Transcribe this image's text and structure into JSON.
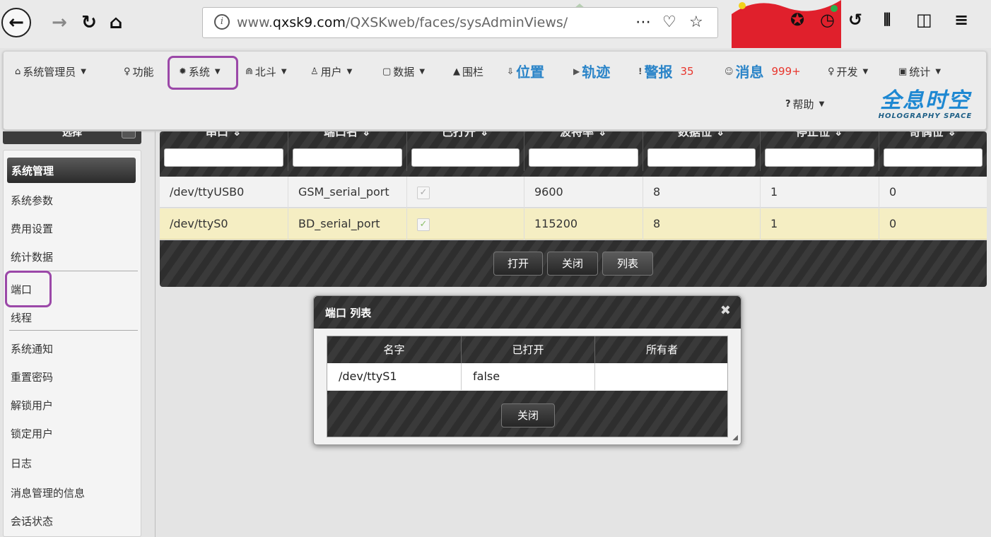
{
  "browser": {
    "url_prefix": "www.",
    "url_host": "qxsk9.com",
    "url_path": "/QXSKweb/faces/sysAdminViews/",
    "icons": [
      "back-icon",
      "forward-icon",
      "reload-icon",
      "home-icon",
      "info-icon",
      "more-icon",
      "pocket-icon",
      "bookmark-star-icon",
      "extension-icon",
      "clock-icon",
      "history-icon",
      "library-icon",
      "sidebar-icon",
      "hamburger-menu-icon"
    ]
  },
  "navbar": {
    "items": [
      {
        "icon": "⌂",
        "label": "系统管理员",
        "caret": true
      },
      {
        "icon": "♀",
        "label": "功能",
        "caret": false
      },
      {
        "icon": "✹",
        "label": "系统",
        "caret": true
      },
      {
        "icon": "⋒",
        "label": "北斗",
        "caret": true
      },
      {
        "icon": "♙",
        "label": "用户",
        "caret": true
      },
      {
        "icon": "▢",
        "label": "数据",
        "caret": true
      },
      {
        "icon": "▲",
        "label": "围栏",
        "caret": false
      }
    ],
    "big_items": [
      {
        "icon": "⇩",
        "label": "位置"
      },
      {
        "icon": "▶",
        "label": "轨迹"
      },
      {
        "icon": "!",
        "label": "警报",
        "badge": "35"
      },
      {
        "icon": "☺",
        "label": "消息",
        "badge": "999+"
      }
    ],
    "right_items": [
      {
        "icon": "♀",
        "label": "开发",
        "caret": true
      },
      {
        "icon": "▣",
        "label": "统计",
        "caret": true
      }
    ],
    "help": {
      "icon": "?",
      "label": "帮助"
    },
    "logo": {
      "zh": "全息时空",
      "en": "HOLOGRAPHY SPACE"
    }
  },
  "sidebar": {
    "header": "选择",
    "items": [
      "系统管理",
      "系统参数",
      "费用设置",
      "统计数据",
      "端口",
      "线程",
      "系统通知",
      "重置密码",
      "解锁用户",
      "锁定用户",
      "日志",
      "消息管理的信息",
      "会话状态"
    ],
    "active": "系统管理"
  },
  "table": {
    "columns": [
      "串口",
      "端口名",
      "已打开",
      "波特率",
      "数据位",
      "停止位",
      "奇偶位"
    ],
    "rows": [
      {
        "port": "/dev/ttyUSB0",
        "name": "GSM_serial_port",
        "open": true,
        "baud": "9600",
        "data_bits": "8",
        "stop_bits": "1",
        "parity": "0"
      },
      {
        "port": "/dev/ttyS0",
        "name": "BD_serial_port",
        "open": true,
        "baud": "115200",
        "data_bits": "8",
        "stop_bits": "1",
        "parity": "0"
      }
    ],
    "selected_row": 1,
    "buttons": [
      "打开",
      "关闭",
      "列表"
    ]
  },
  "dialog": {
    "title": "端口 列表",
    "columns": [
      "名字",
      "已打开",
      "所有者"
    ],
    "rows": [
      {
        "name": "/dev/ttyS1",
        "open": "false",
        "owner": ""
      }
    ],
    "close_label": "关闭"
  },
  "colors": {
    "accent_blue": "#2a84c8",
    "badge_red": "#e8352c",
    "highlight_purple": "#9b48a8",
    "selected_row": "#f5eec3"
  }
}
